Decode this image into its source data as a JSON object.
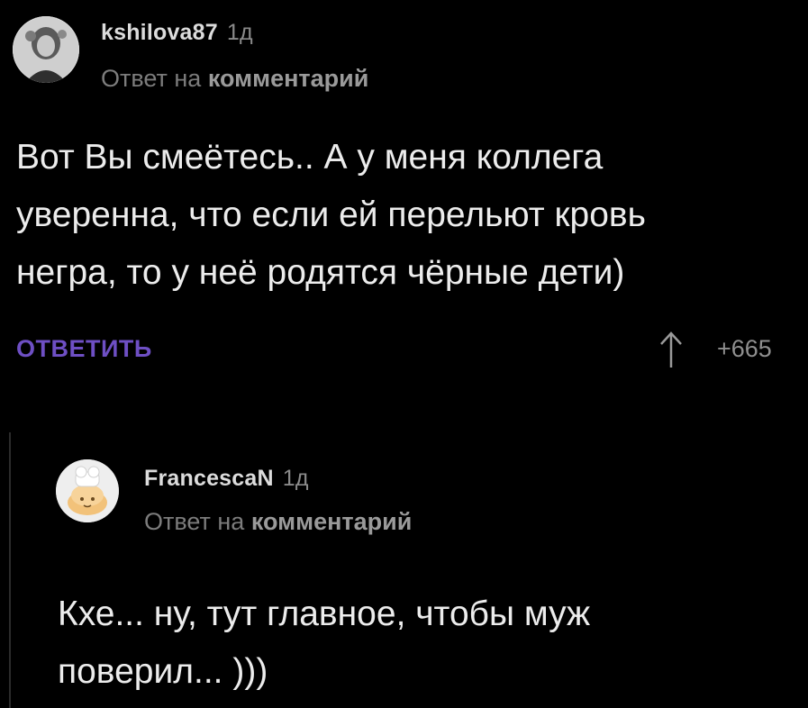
{
  "comments": [
    {
      "author": "kshilova87",
      "time": "1д",
      "reply_prefix": "Ответ на",
      "reply_link": "комментарий",
      "lines": [
        "Вот Вы смеётесь.. А у меня коллега",
        "уверенна, что если ей перельют кровь",
        "негра, то у неё родятся чёрные дети)"
      ],
      "reply_label": "ОТВЕТИТЬ",
      "rating": "+665",
      "avatar_icon": "user-photo-avatar"
    },
    {
      "author": "FrancescaN",
      "time": "1д",
      "reply_prefix": "Ответ на",
      "reply_link": "комментарий",
      "lines": [
        "Кхе... ну, тут главное, чтобы муж",
        "поверил... )))"
      ],
      "avatar_icon": "default-avatar-icon"
    }
  ],
  "colors": {
    "background": "#000000",
    "accent": "#6e4fc4",
    "muted": "#7c7c7c"
  }
}
